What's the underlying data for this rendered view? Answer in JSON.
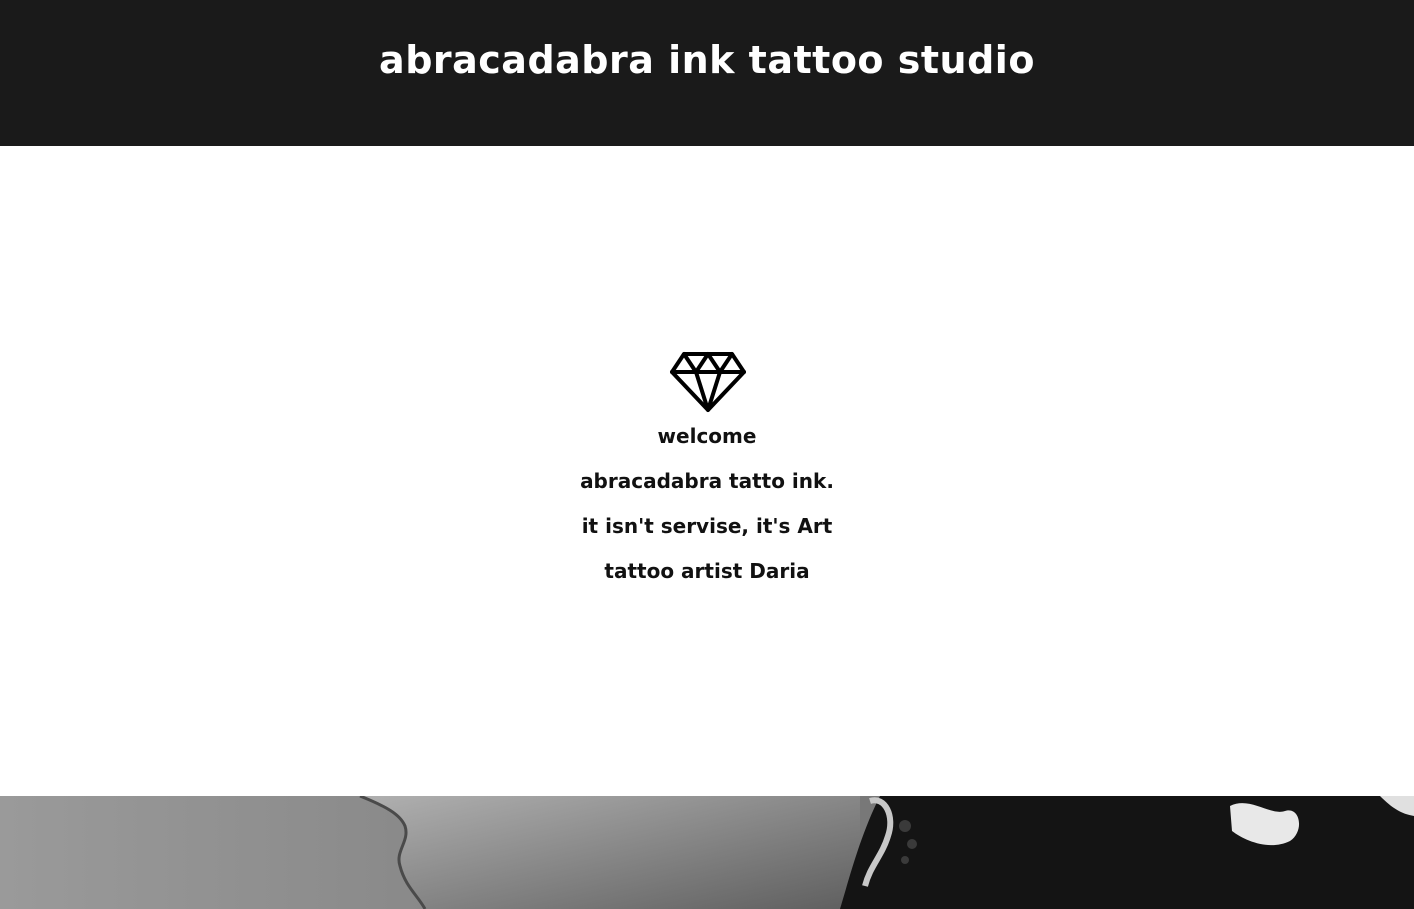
{
  "header": {
    "title": "abracadabra ink tattoo studio"
  },
  "intro": {
    "icon": "diamond-icon",
    "lines": [
      "welcome",
      "abracadabra tatto ink.",
      "it isn't servise, it's Art",
      "tattoo artist Daria"
    ]
  },
  "photo": {
    "description_icon": "portrait-photo"
  },
  "colors": {
    "header_bg": "#1a1a1a",
    "header_text": "#ffffff",
    "body_text": "#111111",
    "page_bg": "#ffffff"
  }
}
